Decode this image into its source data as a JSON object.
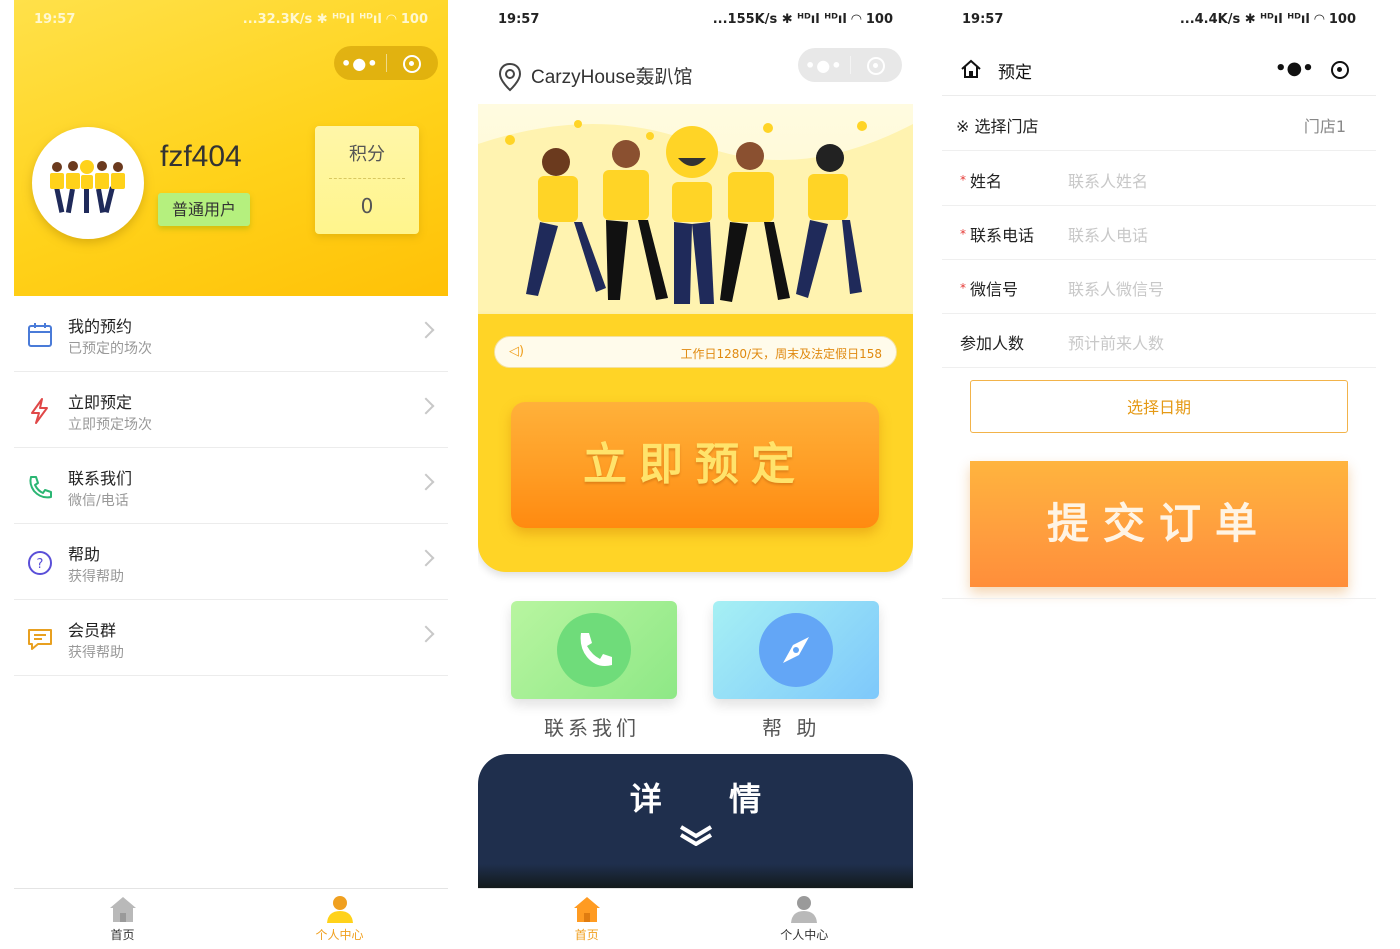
{
  "profile_screen": {
    "status": {
      "time": "19:57",
      "right": "...32.3K/s ✱ ᴴᴰıl ᴴᴰıl ◠ 100"
    },
    "capsule": {
      "dots": "•●•"
    },
    "user": {
      "name": "fzf404",
      "role": "普通用户"
    },
    "points": {
      "label": "积分",
      "value": "0"
    },
    "menu": [
      {
        "title": "我的预约",
        "subtitle": "已预定的场次",
        "icon": "calendar-icon"
      },
      {
        "title": "立即预定",
        "subtitle": "立即预定场次",
        "icon": "lightning-icon"
      },
      {
        "title": "联系我们",
        "subtitle": "微信/电话",
        "icon": "phone-icon"
      },
      {
        "title": "帮助",
        "subtitle": "获得帮助",
        "icon": "question-icon"
      },
      {
        "title": "会员群",
        "subtitle": "获得帮助",
        "icon": "chat-icon"
      }
    ],
    "tabbar": {
      "home": "首页",
      "profile": "个人中心"
    },
    "colors": {
      "header": "#ffd21a",
      "active_tab": "#f0a020"
    }
  },
  "home_screen": {
    "status": {
      "time": "19:57",
      "right": "...155K/s ✱ ᴴᴰıl ᴴᴰıl ◠ 100"
    },
    "capsule": {
      "dots": "•●•"
    },
    "location": "CarzyHouse轰趴馆",
    "notice": "工作日1280/天，周末及法定假日158",
    "book_button": "立即预定",
    "contact_label": "联系我们",
    "help_label": "帮 助",
    "detail_title": "详 情",
    "tabbar": {
      "home": "首页",
      "profile": "个人中心"
    },
    "colors": {
      "card": "#ffd426",
      "button": "#ff9b22",
      "detail_bg": "#1f2f4d"
    }
  },
  "booking_screen": {
    "status": {
      "time": "19:57",
      "right": "...4.4K/s ✱ ᴴᴰıl ᴴᴰıl ◠ 100"
    },
    "nav_title": "预定",
    "nav_dots": "•●•",
    "store_label": "※ 选择门店",
    "store_value": "门店1",
    "fields": [
      {
        "label": "姓名",
        "placeholder": "联系人姓名",
        "required": "*"
      },
      {
        "label": "联系电话",
        "placeholder": "联系人电话",
        "required": "*"
      },
      {
        "label": "微信号",
        "placeholder": "联系人微信号",
        "required": "*"
      },
      {
        "label": "参加人数",
        "placeholder": "预计前来人数",
        "required": ""
      }
    ],
    "date_button": "选择日期",
    "submit_button": "提交订单"
  }
}
